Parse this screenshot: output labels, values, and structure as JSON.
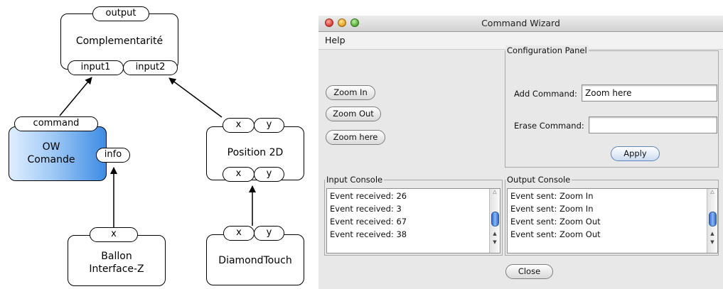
{
  "diagram": {
    "complementarite": {
      "title": "Complementarité",
      "output": "output",
      "input1": "input1",
      "input2": "input2"
    },
    "ow": {
      "title_line1": "OW",
      "title_line2": "Comande",
      "command": "command",
      "info": "info"
    },
    "position2d": {
      "title": "Position 2D",
      "in_x": "x",
      "in_y": "y",
      "out_x": "x",
      "out_y": "y"
    },
    "ballon": {
      "title_line1": "Ballon",
      "title_line2": "Interface-Z",
      "x": "x"
    },
    "diamond": {
      "title": "DiamondTouch",
      "x": "x",
      "y": "y"
    },
    "colors": {
      "ow_gradient_start": "#dfeeff",
      "ow_gradient_end": "#3e8ce4"
    }
  },
  "window": {
    "title": "Command Wizard",
    "menu": {
      "help": "Help"
    },
    "buttons": {
      "zoom_in": "Zoom In",
      "zoom_out": "Zoom Out",
      "zoom_here": "Zoom here",
      "apply": "Apply",
      "close": "Close"
    },
    "config_panel": {
      "legend": "Configuration Panel",
      "add_label": "Add Command:",
      "add_value": "Zoom here",
      "erase_label": "Erase Command:",
      "erase_value": ""
    },
    "input_console": {
      "legend": "Input Console",
      "lines": [
        "Event received: 26",
        "Event received: 3",
        "Event received: 67",
        "Event received: 38"
      ]
    },
    "output_console": {
      "legend": "Output Console",
      "lines": [
        "Event sent: Zoom In",
        "Event sent: Zoom In",
        "Event sent: Zoom Out",
        "Event sent: Zoom Out"
      ]
    }
  }
}
